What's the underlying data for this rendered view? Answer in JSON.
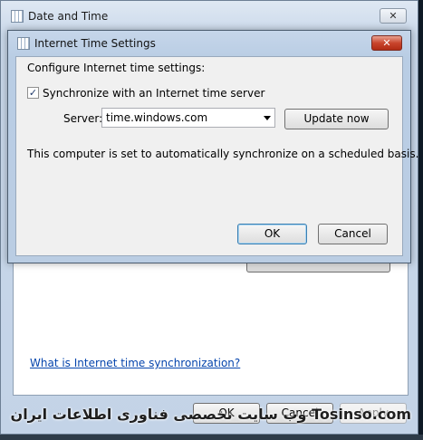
{
  "outer_window": {
    "title": "Date and Time",
    "close_glyph": "✕",
    "help_link": "What is Internet time synchronization?",
    "buttons": {
      "ok": "OK",
      "cancel": "Cancel",
      "apply": "Apply"
    }
  },
  "inner_dialog": {
    "title": "Internet Time Settings",
    "close_glyph": "✕",
    "heading": "Configure Internet time settings:",
    "sync_checkbox": {
      "label": "Synchronize with an Internet time server",
      "checked": true,
      "mark": "✓"
    },
    "server": {
      "label": "Server:",
      "value": "time.windows.com"
    },
    "update_button": "Update now",
    "status_text": "This computer is set to automatically synchronize on a scheduled basis.",
    "buttons": {
      "ok": "OK",
      "cancel": "Cancel"
    }
  },
  "watermark": "وب سایت تخصصی فناوری اطلاعات ایران Tosinso.com",
  "colors": {
    "close_red": "#c9452d",
    "link": "#0645ad",
    "title_bar": "#c6d6ea"
  },
  "icons": {
    "window_icon": "calendar-clock-icon",
    "dropdown": "chevron-down-icon"
  }
}
